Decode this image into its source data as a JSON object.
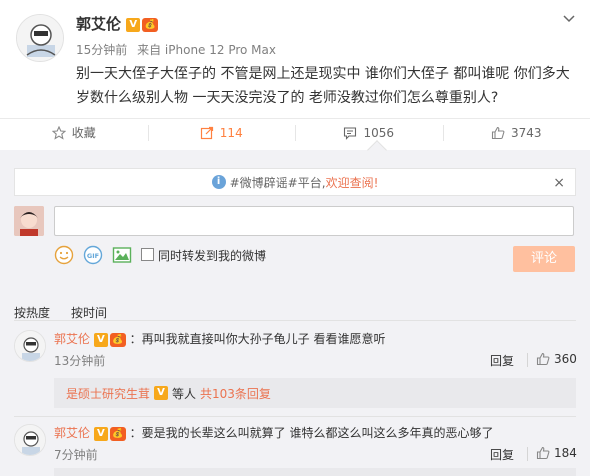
{
  "post": {
    "author": "郭艾伦",
    "vip_badge": "V",
    "member_badge": "💰",
    "time": "15分钟前",
    "source": "来自 iPhone 12 Pro Max",
    "text": "别一天大侄子大侄子的 不管是网上还是现实中 谁你们大侄子 都叫谁呢 你们多大岁数什么级别人物 一天天没完没了的 老师没教过你们怎么尊重别人?"
  },
  "actions": {
    "collect": "收藏",
    "repost": "114",
    "comment": "1056",
    "like": "3743"
  },
  "notice": {
    "tag1": "#微博辟谣#",
    "tag2": "平台,",
    "link": "欢迎查阅!",
    "close": "×"
  },
  "composer": {
    "repost_label": "同时转发到我的微博",
    "submit": "评论"
  },
  "sort": {
    "by_hot": "按热度",
    "by_time": "按时间"
  },
  "comments": [
    {
      "author": "郭艾伦",
      "text": "：再叫我就直接叫你大孙子龟儿子 看看谁愿意听",
      "time": "13分钟前",
      "reply_label": "回复",
      "likes": "360"
    },
    {
      "author": "郭艾伦",
      "text": "：要是我的长辈这么叫就算了 谁特么都这么叫这么多年真的恶心够了",
      "time": "7分钟前",
      "reply_label": "回复",
      "likes": "184"
    }
  ],
  "sub_reply": {
    "name": "是硕士研究生茸",
    "suffix": "等人",
    "count": "共103条回复"
  },
  "colors": {
    "accent": "#eb7350",
    "active_repost": "#ff8140",
    "vip": "#f7a81b",
    "submit_disabled": "#ffc09f",
    "panel_bg": "#f2f2f5"
  }
}
